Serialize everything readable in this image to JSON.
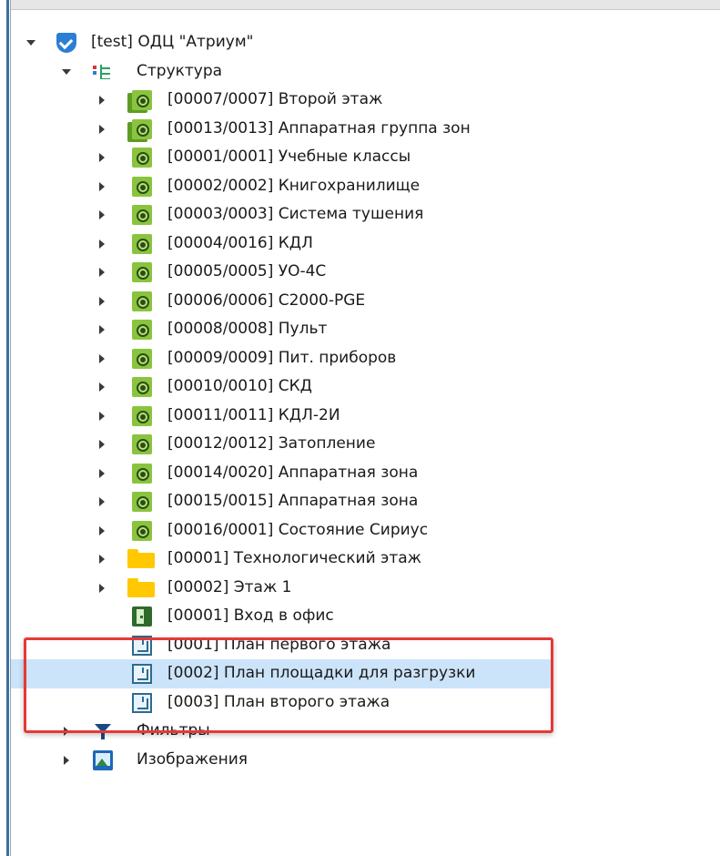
{
  "tree": {
    "root": {
      "label": "[test] ОДЦ \"Атриум\"",
      "icon": "shield-icon"
    },
    "structure": {
      "label": "Структура",
      "icon": "structure-icon"
    },
    "zones": [
      {
        "label": "[00007/0007] Второй этаж",
        "icon": "zone-group-icon"
      },
      {
        "label": "[00013/0013] Аппаратная группа зон",
        "icon": "zone-group-icon"
      },
      {
        "label": "[00001/0001] Учебные классы",
        "icon": "zone-icon"
      },
      {
        "label": "[00002/0002] Книгохранилище",
        "icon": "zone-icon"
      },
      {
        "label": "[00003/0003] Система тушения",
        "icon": "zone-icon"
      },
      {
        "label": "[00004/0016] КДЛ",
        "icon": "zone-icon"
      },
      {
        "label": "[00005/0005] УО-4С",
        "icon": "zone-icon"
      },
      {
        "label": "[00006/0006] С2000-PGE",
        "icon": "zone-icon"
      },
      {
        "label": "[00008/0008] Пульт",
        "icon": "zone-icon"
      },
      {
        "label": "[00009/0009] Пит. приборов",
        "icon": "zone-icon"
      },
      {
        "label": "[00010/0010] СКД",
        "icon": "zone-icon"
      },
      {
        "label": "[00011/0011] КДЛ-2И",
        "icon": "zone-icon"
      },
      {
        "label": "[00012/0012] Затопление",
        "icon": "zone-icon"
      },
      {
        "label": "[00014/0020] Аппаратная зона",
        "icon": "zone-icon"
      },
      {
        "label": "[00015/0015] Аппаратная зона",
        "icon": "zone-icon"
      },
      {
        "label": "[00016/0001] Состояние Сириус",
        "icon": "zone-icon"
      }
    ],
    "folders": [
      {
        "label": "[00001] Технологический этаж",
        "icon": "folder-icon"
      },
      {
        "label": "[00002] Этаж 1",
        "icon": "folder-icon"
      }
    ],
    "door": {
      "label": "[00001] Вход в офис",
      "icon": "door-icon"
    },
    "plans": [
      {
        "label": "[0001] План первого этажа",
        "icon": "floor-plan-icon",
        "selected": false
      },
      {
        "label": "[0002] План площадки для разгрузки",
        "icon": "floor-plan-icon",
        "selected": true
      },
      {
        "label": "[0003] План второго этажа",
        "icon": "floor-plan-icon",
        "selected": false
      }
    ],
    "filters": {
      "label": "Фильтры",
      "icon": "filter-icon"
    },
    "images": {
      "label": "Изображения",
      "icon": "image-icon"
    }
  },
  "colors": {
    "selection": "#cce4fa",
    "highlight_border": "#e53935",
    "zone_green": "#8ac43f",
    "folder_yellow": "#ffc800"
  }
}
